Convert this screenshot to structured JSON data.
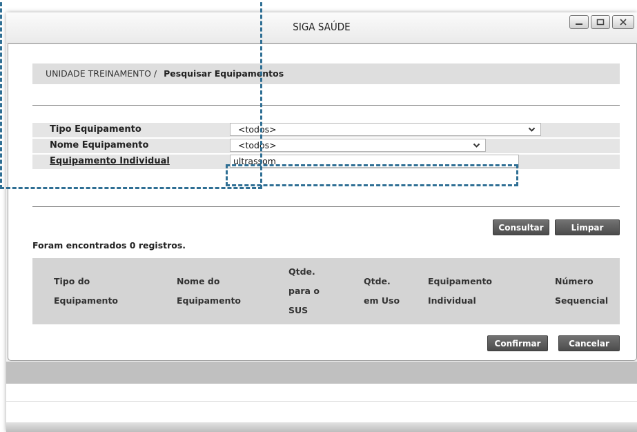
{
  "window": {
    "title": "SIGA SAÚDE",
    "controls": {
      "minimize": "_",
      "maximize": "□",
      "close": "x"
    }
  },
  "breadcrumb": {
    "parent": "UNIDADE TREINAMENTO /",
    "current": "Pesquisar Equipamentos"
  },
  "form": {
    "tipo_equipamento": {
      "label": "Tipo Equipamento",
      "value": "<todos>"
    },
    "nome_equipamento": {
      "label": "Nome Equipamento",
      "value": "<todos>"
    },
    "equipamento_individual": {
      "label": "Equipamento Individual",
      "value": "ultrassom"
    }
  },
  "buttons": {
    "consultar": "Consultar",
    "limpar": "Limpar",
    "confirmar": "Confirmar",
    "cancelar": "Cancelar"
  },
  "results": {
    "count_text": "Foram encontrados 0 registros.",
    "columns": [
      "Tipo do\nEquipamento",
      "Nome do\nEquipamento",
      "Qtde.\npara o\nSUS",
      "Qtde.\nem Uso",
      "Equipamento\nIndividual",
      "Número\nSequencial"
    ]
  },
  "colors": {
    "highlight": "#2f6f94",
    "button": "#5e5e5e",
    "row_background": "#e5e5e5",
    "header_background": "#d4d4d4"
  },
  "icons": {
    "dropdown": "chevron-down-icon"
  }
}
